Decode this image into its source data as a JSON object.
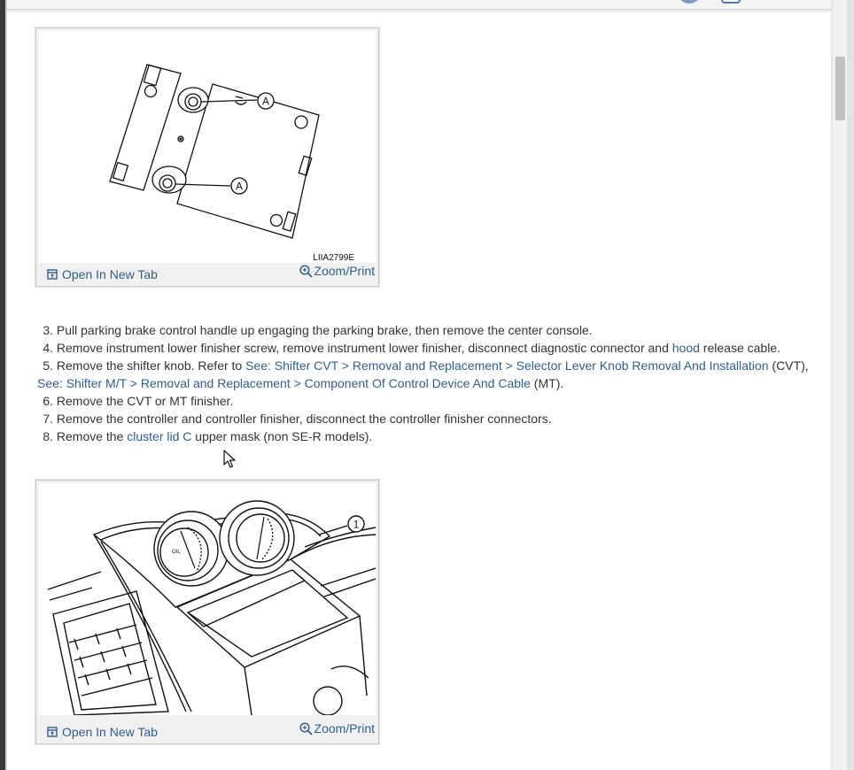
{
  "figures": [
    {
      "code": "LIIA2799E",
      "callout": "A",
      "open_label": "Open In New Tab",
      "zoom_label": "Zoom/Print"
    },
    {
      "callout": "1",
      "gauge_label": "OIL",
      "open_label": "Open In New Tab",
      "zoom_label": "Zoom/Print"
    }
  ],
  "steps": {
    "s3": {
      "num": "3.",
      "text": "Pull parking brake control handle up engaging the parking brake, then remove the center console."
    },
    "s4": {
      "num": "4.",
      "pre": "Remove instrument lower finisher screw, remove instrument lower finisher, disconnect diagnostic connector and ",
      "link": "hood",
      "post": " release cable."
    },
    "s5": {
      "num": "5.",
      "pre": "Remove the shifter knob. Refer to ",
      "link1": "See: Shifter CVT > Removal and Replacement > Selector Lever Knob Removal And Installation",
      "mid": " (CVT),",
      "link2": "See: Shifter M/T > Removal and Replacement > Component Of Control Device And Cable",
      "post": " (MT)."
    },
    "s6": {
      "num": "6.",
      "text": "Remove the CVT or MT finisher."
    },
    "s7": {
      "num": "7.",
      "text": "Remove the controller and controller finisher, disconnect the controller finisher connectors."
    },
    "s8": {
      "num": "8.",
      "pre": "Remove the ",
      "link": "cluster lid C",
      "post": " upper mask (non SE-R models)."
    }
  },
  "icons": {
    "open": "open-in-new-tab-icon",
    "zoom": "zoom-in-icon",
    "cursor": "mouse-cursor-icon"
  },
  "colors": {
    "link": "#2f5f8f",
    "text": "#333333",
    "figure_bg": "#f0f0f0"
  }
}
